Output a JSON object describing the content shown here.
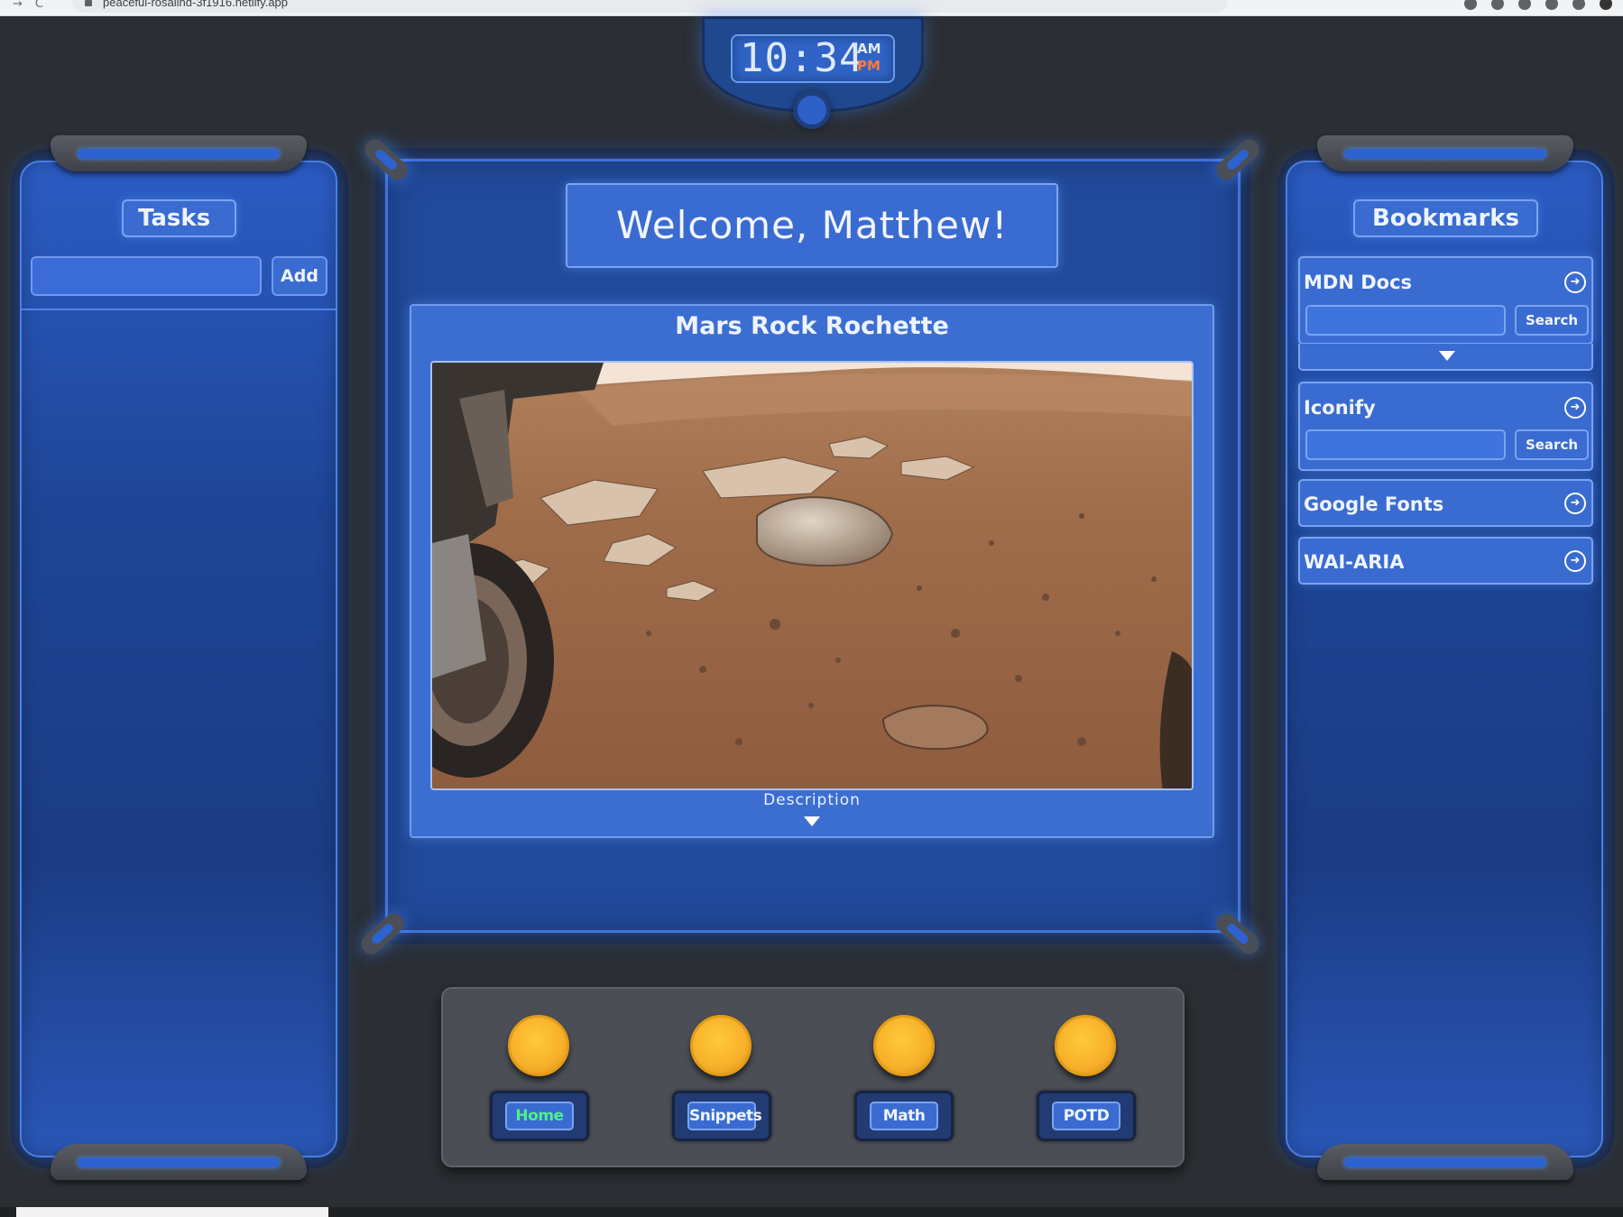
{
  "browser": {
    "url": "peaceful-rosalind-3f1916.netlify.app"
  },
  "clock": {
    "time": "10:34",
    "am": "AM",
    "pm": "PM",
    "active_period": "PM",
    "active_color": "#ff7a3d"
  },
  "tasks": {
    "title": "Tasks",
    "input_value": "",
    "add_label": "Add"
  },
  "welcome": {
    "text": "Welcome, Matthew!"
  },
  "potd": {
    "title": "Mars Rock Rochette",
    "description_label": "Description"
  },
  "nav": {
    "items": [
      {
        "label": "Home",
        "active": true,
        "active_color": "#4cf08a"
      },
      {
        "label": "Snippets",
        "active": false
      },
      {
        "label": "Math",
        "active": false
      },
      {
        "label": "POTD",
        "active": false
      }
    ]
  },
  "bookmarks": {
    "title": "Bookmarks",
    "items": [
      {
        "label": "MDN Docs",
        "search_label": "Search",
        "has_search": true,
        "expandable": true
      },
      {
        "label": "Iconify",
        "search_label": "Search",
        "has_search": true,
        "expandable": false
      },
      {
        "label": "Google Fonts",
        "has_search": false
      },
      {
        "label": "WAI-ARIA",
        "has_search": false
      }
    ]
  },
  "colors": {
    "background": "#2b2e33",
    "panel_blue": "#224a9c",
    "accent_blue": "#3a6bd0",
    "nav_light": "#f7b02a"
  }
}
